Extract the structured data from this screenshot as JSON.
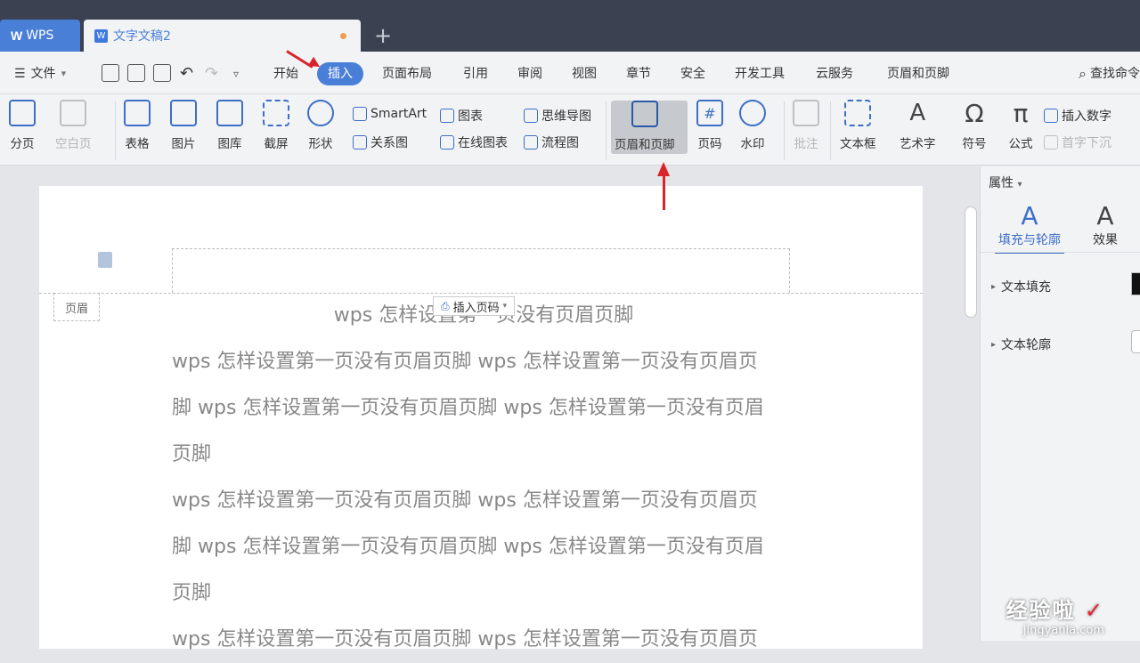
{
  "titlebar": {
    "wps_label": "WPS",
    "doc_title": "文字文稿2",
    "new_tab": "+"
  },
  "menubar": {
    "file": "文件",
    "tabs": [
      "开始",
      "插入",
      "页面布局",
      "引用",
      "审阅",
      "视图",
      "章节",
      "安全",
      "开发工具",
      "云服务",
      "页眉和页脚"
    ],
    "search": "查找命令"
  },
  "ribbon": {
    "page_break": "分页",
    "blank_page": "空白页",
    "table": "表格",
    "picture": "图片",
    "gallery": "图库",
    "screenshot": "截屏",
    "shape": "形状",
    "smartart": "SmartArt",
    "chart": "图表",
    "mindmap": "思维导图",
    "relation": "关系图",
    "online_chart": "在线图表",
    "flowchart": "流程图",
    "header_footer": "页眉和页脚",
    "page_number": "页码",
    "watermark": "水印",
    "comment": "批注",
    "textbox": "文本框",
    "wordart": "艺术字",
    "symbol": "符号",
    "formula": "公式",
    "insert_number": "插入数字",
    "drop_cap": "首字下沉",
    "symbol_glyph": "Ω",
    "formula_glyph": "π",
    "wordart_glyph": "A"
  },
  "document": {
    "header_label": "页眉",
    "insert_page_number": "插入页码",
    "line_center": "wps 怎样设置第一页没有页眉页脚",
    "paragraph_lines": [
      "wps 怎样设置第一页没有页眉页脚 wps 怎样设置第一页没有页眉页",
      "脚 wps 怎样设置第一页没有页眉页脚 wps 怎样设置第一页没有页眉",
      "页脚",
      "wps 怎样设置第一页没有页眉页脚 wps 怎样设置第一页没有页眉页",
      "脚 wps 怎样设置第一页没有页眉页脚 wps 怎样设置第一页没有页眉",
      "页脚",
      "wps 怎样设置第一页没有页眉页脚 wps 怎样设置第一页没有页眉页"
    ]
  },
  "right_panel": {
    "title": "属性",
    "tab_fill": "填充与轮廓",
    "tab_effect": "效果",
    "text_fill": "文本填充",
    "text_outline": "文本轮廓",
    "tab_glyph": "A"
  },
  "watermark": {
    "line1": "经验啦",
    "line2": "jingyanla.com",
    "check": "✓"
  },
  "colors": {
    "accent": "#4a7fd8",
    "titlebar": "#3c4152",
    "arrow": "#d9242a"
  }
}
